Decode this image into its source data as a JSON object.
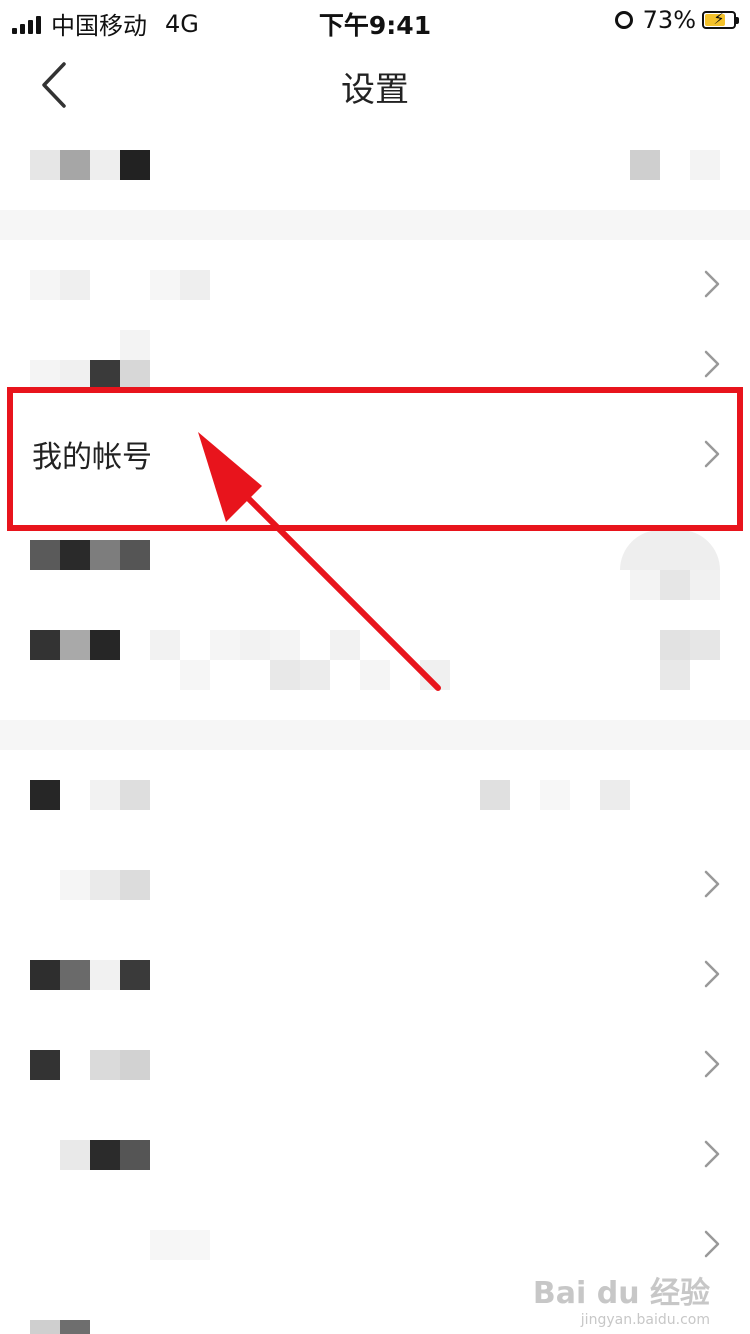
{
  "status_bar": {
    "carrier": "中国移动",
    "network": "4G",
    "time": "下午9:41",
    "battery_percent": "73%",
    "battery_level": 0.73,
    "icons": [
      "signal-icon",
      "alarm-icon",
      "battery-charging-icon"
    ]
  },
  "nav": {
    "title": "设置",
    "back_icon": "chevron-left-icon"
  },
  "account_row": {
    "label": "我的帐号",
    "icon": "chevron-right-icon"
  },
  "watermark": {
    "main": "Bai du 经验",
    "sub": "jingyan.baidu.com"
  },
  "colors": {
    "highlight": "#e8141c",
    "arrow": "#e8141c",
    "battery": "#f4c22b"
  }
}
